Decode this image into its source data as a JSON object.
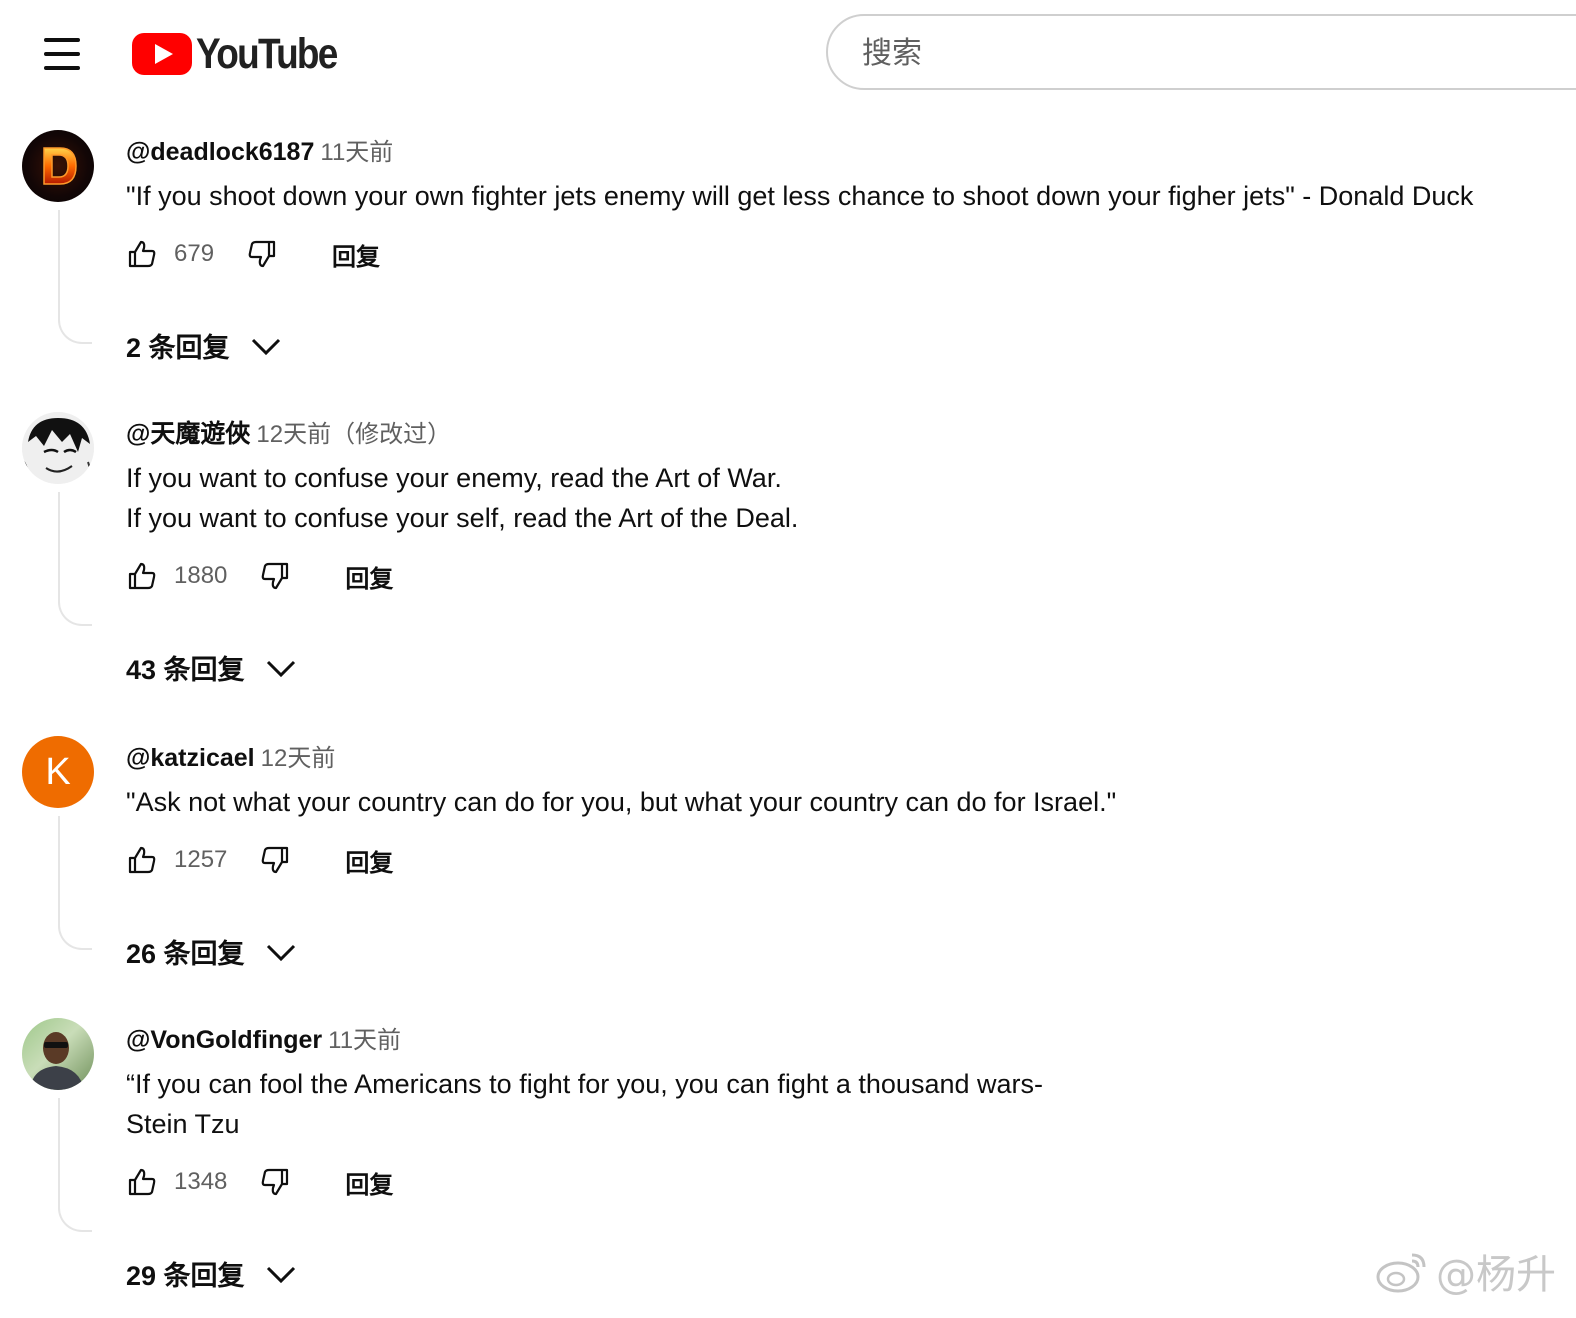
{
  "header": {
    "menu_icon": "hamburger-menu-icon",
    "logo_text": "YouTube",
    "search_placeholder": "搜索"
  },
  "comments": [
    {
      "author": "@deadlock6187",
      "time": "11天前",
      "avatar": "red-flame-letter-D",
      "lines": [
        "\"If you shoot down your own fighter jets enemy will get less chance to shoot down your figher jets\" - Donald Duck"
      ],
      "likes": "679",
      "reply_label": "回复",
      "replies_label": "2 条回复"
    },
    {
      "author": "@天魔遊俠",
      "time": "12天前（修改过）",
      "avatar": "manga-sketch-face",
      "lines": [
        "If you want to confuse your enemy, read the Art of War.",
        "If you want to confuse your self, read the Art of the Deal."
      ],
      "likes": "1880",
      "reply_label": "回复",
      "replies_label": "43 条回复"
    },
    {
      "author": "@katzicael",
      "time": "12天前",
      "avatar_letter": "K",
      "avatar_color": "#ef6c00",
      "lines": [
        "\"Ask not what your country can do for you, but what your country can do for Israel.\""
      ],
      "likes": "1257",
      "reply_label": "回复",
      "replies_label": "26 条回复"
    },
    {
      "author": "@VonGoldfinger",
      "time": "11天前",
      "avatar": "man-with-sunglasses-photo",
      "lines": [
        "“If you can fool the Americans to fight for you, you can fight a thousand wars-",
        "Stein Tzu"
      ],
      "likes": "1348",
      "reply_label": "回复",
      "replies_label": "29 条回复"
    }
  ],
  "watermark": {
    "icon": "weibo-icon",
    "text": "@杨升"
  },
  "colors": {
    "brand_red": "#ff0000",
    "text_primary": "#0f0f0f",
    "text_secondary": "#606060"
  }
}
